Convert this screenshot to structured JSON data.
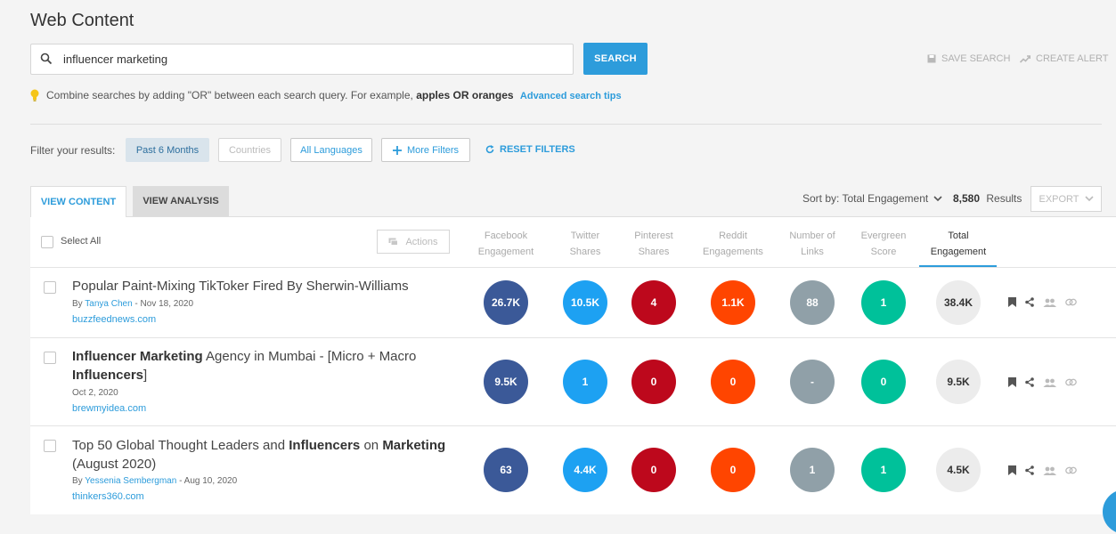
{
  "page": {
    "title": "Web Content"
  },
  "search": {
    "value": "influencer marketing",
    "button_label": "SEARCH"
  },
  "top_actions": {
    "save_search": "SAVE SEARCH",
    "create_alert": "CREATE ALERT"
  },
  "tip": {
    "text": "Combine searches by adding \"OR\" between each search query. For example,",
    "example": "apples OR oranges",
    "link": "Advanced search tips"
  },
  "filters": {
    "label": "Filter your results:",
    "chips": [
      "Past 6 Months",
      "Countries",
      "All Languages",
      "More Filters"
    ],
    "reset": "RESET FILTERS"
  },
  "tabs": {
    "view_content": "VIEW CONTENT",
    "view_analysis": "VIEW ANALYSIS"
  },
  "sort": {
    "label": "Sort by: Total Engagement"
  },
  "results": {
    "count": "8,580",
    "label": "Results"
  },
  "export": {
    "label": "EXPORT"
  },
  "table": {
    "select_all": "Select All",
    "actions_label": "Actions",
    "columns": [
      {
        "line1": "Facebook",
        "line2": "Engagement"
      },
      {
        "line1": "Twitter",
        "line2": "Shares"
      },
      {
        "line1": "Pinterest",
        "line2": "Shares"
      },
      {
        "line1": "Reddit",
        "line2": "Engagements"
      },
      {
        "line1": "Number of",
        "line2": "Links"
      },
      {
        "line1": "Evergreen",
        "line2": "Score"
      },
      {
        "line1": "Total",
        "line2": "Engagement"
      }
    ]
  },
  "colors": {
    "accent": "#2d9cdb",
    "facebook": "#3b5998",
    "twitter": "#1da1f2",
    "pinterest": "#bd081c",
    "reddit": "#ff4500",
    "links": "#90a0a8",
    "evergreen": "#00c19a",
    "total": "#ececec"
  },
  "articles": [
    {
      "title_parts": [
        {
          "text": "Popular Paint-Mixing TikToker Fired By Sherwin-Williams",
          "bold": false
        }
      ],
      "by": "By ",
      "author": "Tanya Chen",
      "date": " - Nov 18, 2020",
      "domain": "buzzfeednews.com",
      "metrics": [
        "26.7K",
        "10.5K",
        "4",
        "1.1K",
        "88",
        "1",
        "38.4K"
      ]
    },
    {
      "title_parts": [
        {
          "text": "Influencer Marketing",
          "bold": true
        },
        {
          "text": " Agency in Mumbai - [Micro + Macro ",
          "bold": false
        },
        {
          "text": "Influencers",
          "bold": true
        },
        {
          "text": "]",
          "bold": false
        }
      ],
      "by": "",
      "author": "",
      "date": "Oct 2, 2020",
      "domain": "brewmyidea.com",
      "metrics": [
        "9.5K",
        "1",
        "0",
        "0",
        "-",
        "0",
        "9.5K"
      ]
    },
    {
      "title_parts": [
        {
          "text": "Top 50 Global Thought Leaders and ",
          "bold": false
        },
        {
          "text": "Influencers",
          "bold": true
        },
        {
          "text": " on ",
          "bold": false
        },
        {
          "text": "Marketing",
          "bold": true
        },
        {
          "text": " (August 2020)",
          "bold": false
        }
      ],
      "by": "By ",
      "author": "Yessenia Sembergman",
      "date": " - Aug 10, 2020",
      "domain": "thinkers360.com",
      "metrics": [
        "63",
        "4.4K",
        "0",
        "0",
        "1",
        "1",
        "4.5K"
      ]
    }
  ]
}
